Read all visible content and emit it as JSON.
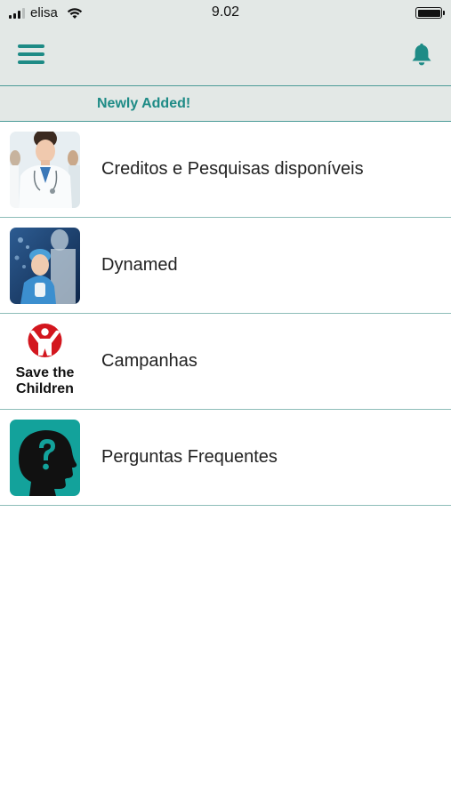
{
  "status_bar": {
    "carrier": "elisa",
    "time": "9.02"
  },
  "nav": {
    "menu_icon": "hamburger-menu-icon",
    "bell_icon": "bell-icon"
  },
  "section": {
    "title": "Newly Added!"
  },
  "items": [
    {
      "label": "Creditos e Pesquisas disponíveis",
      "icon": "doctor-photo"
    },
    {
      "label": "Dynamed",
      "icon": "medical-researcher-photo"
    },
    {
      "label": "Campanhas",
      "icon": "save-the-children-logo",
      "logo_text": "Save the Children"
    },
    {
      "label": "Perguntas Frequentes",
      "icon": "question-head-icon"
    }
  ],
  "colors": {
    "accent": "#1e8b86",
    "header_bg": "#e3e8e6",
    "divider": "#8cbcb7",
    "logo_red": "#d3161e"
  }
}
